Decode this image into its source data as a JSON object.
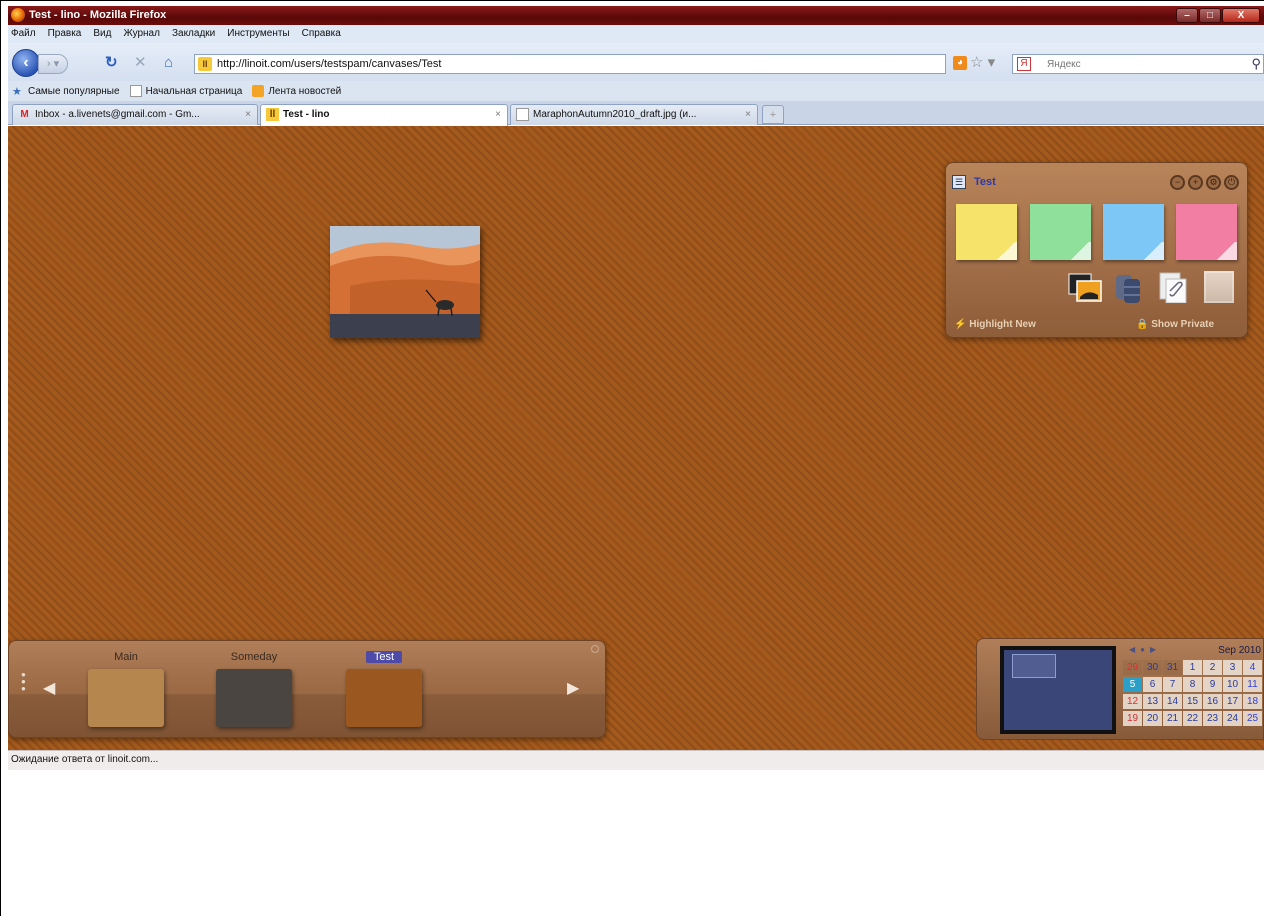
{
  "window": {
    "title": "Test - lino - Mozilla Firefox",
    "min": "–",
    "max": "□",
    "close": "X"
  },
  "menu": [
    "Файл",
    "Правка",
    "Вид",
    "Журнал",
    "Закладки",
    "Инструменты",
    "Справка"
  ],
  "nav": {
    "url": "http://linoit.com/users/testspam/canvases/Test",
    "search_engine": "Я",
    "search_placeholder": "Яндекс"
  },
  "bookmarks": [
    "Самые популярные",
    "Начальная страница",
    "Лента новостей"
  ],
  "tabs": [
    {
      "label": "Inbox - a.livenets@gmail.com - Gm...",
      "close": "×"
    },
    {
      "label": "Test - lino",
      "close": "×"
    },
    {
      "label": "MaraphonAutumn2010_draft.jpg (и...",
      "close": "×"
    }
  ],
  "tab_new": "+",
  "toolbox": {
    "canvas_name": "Test",
    "sticky_colors": [
      "#f6e46a",
      "#8fe09a",
      "#7cc7f5",
      "#f27fa3"
    ],
    "highlight_label": "Highlight New",
    "private_label": "Show Private"
  },
  "canvases": {
    "items": [
      {
        "label": "Main",
        "color": "#b5864e"
      },
      {
        "label": "Someday",
        "color": "#4a4540"
      },
      {
        "label": "Test",
        "color": "#9a571f"
      }
    ],
    "active_index": 2
  },
  "calendar": {
    "month": "Sep 2010",
    "days": [
      "29",
      "30",
      "31",
      "1",
      "2",
      "3",
      "4",
      "5",
      "6",
      "7",
      "8",
      "9",
      "10",
      "11",
      "12",
      "13",
      "14",
      "15",
      "16",
      "17",
      "18",
      "19",
      "20",
      "21",
      "22",
      "23",
      "24",
      "25"
    ],
    "today": "5"
  },
  "status": "Ожидание ответа от linoit.com..."
}
